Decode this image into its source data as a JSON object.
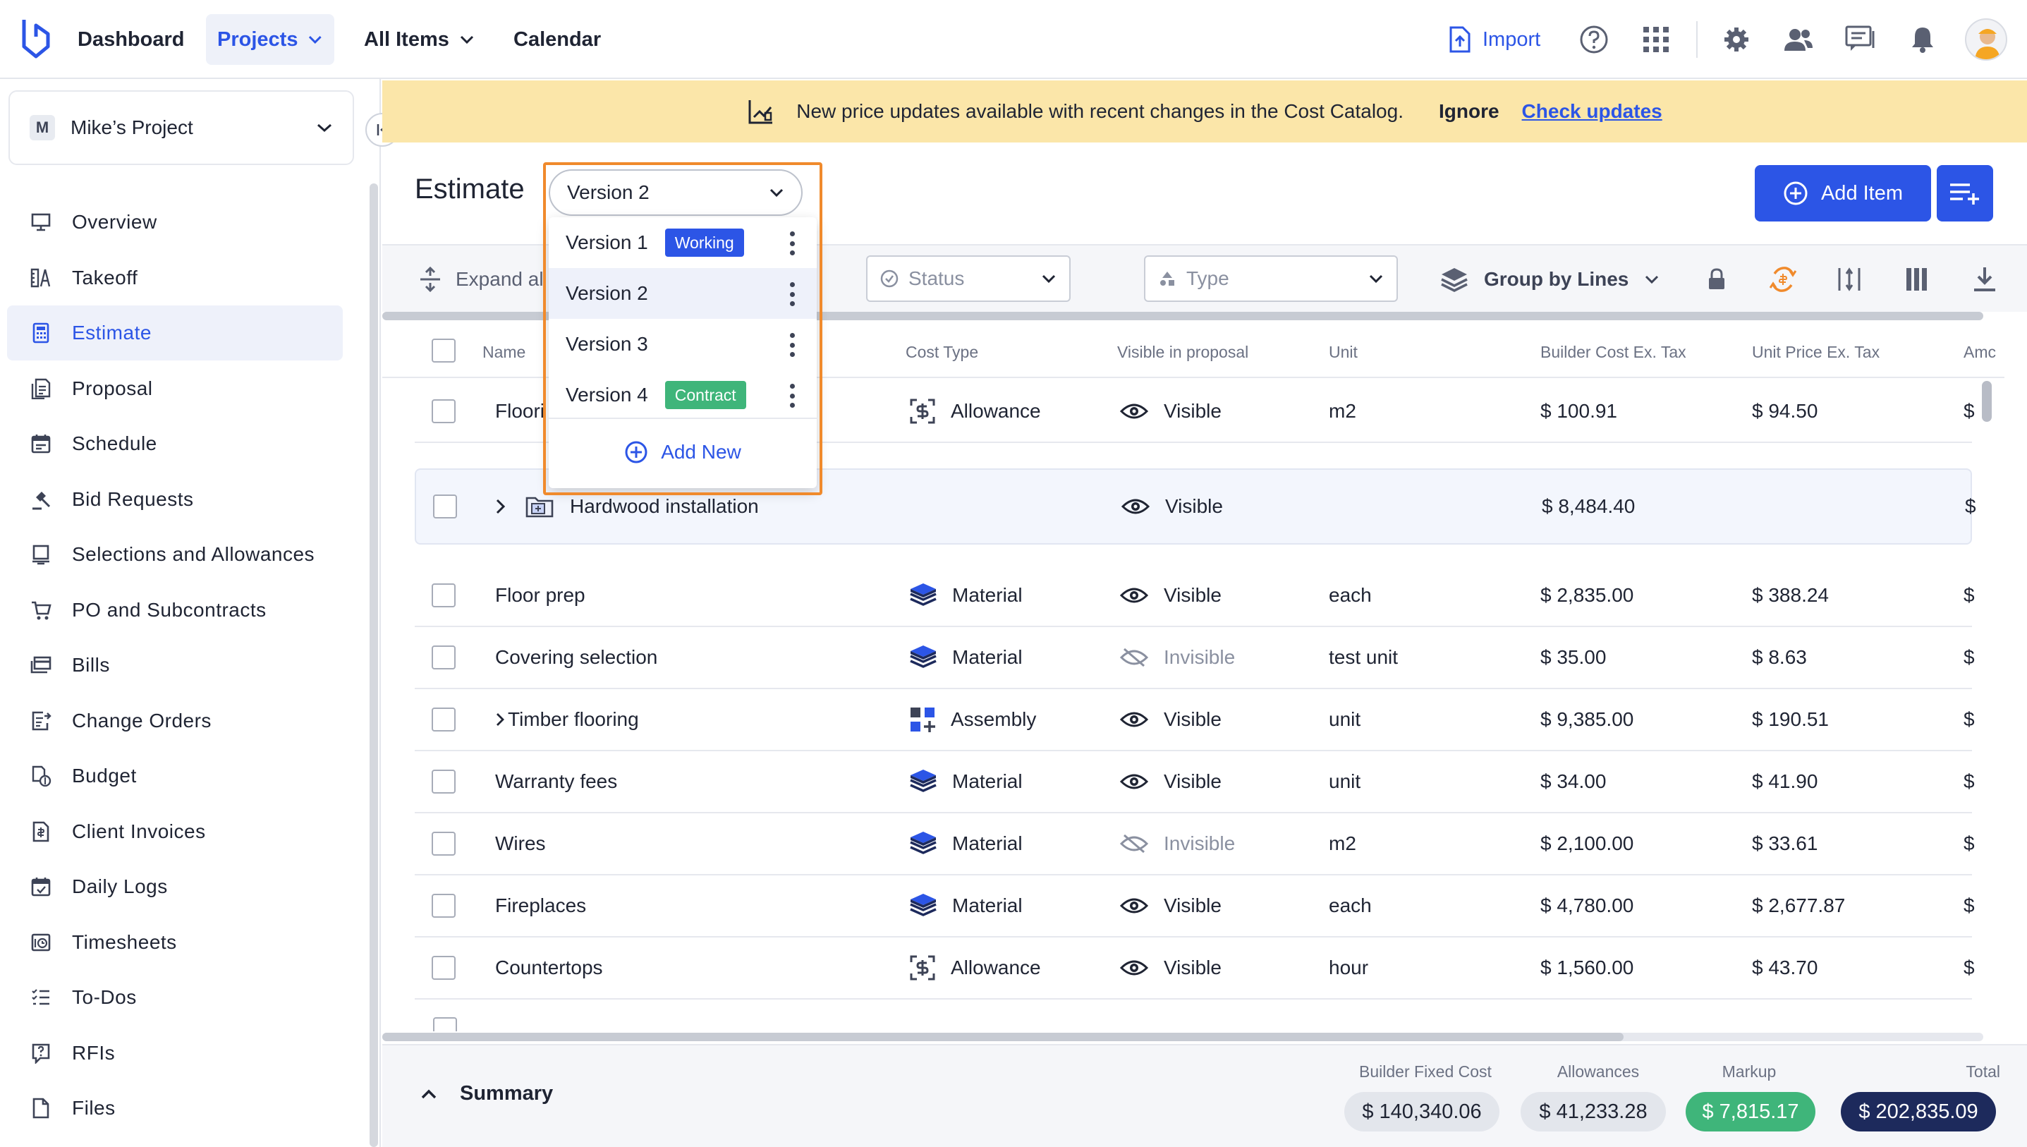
{
  "topnav": {
    "items": [
      {
        "label": "Dashboard"
      },
      {
        "label": "Projects"
      },
      {
        "label": "All Items"
      },
      {
        "label": "Calendar"
      }
    ],
    "import_label": "Import"
  },
  "project": {
    "badge": "M",
    "name": "Mike’s Project"
  },
  "sidebar": {
    "items": [
      {
        "label": "Overview",
        "icon": "monitor-icon"
      },
      {
        "label": "Takeoff",
        "icon": "takeoff-icon"
      },
      {
        "label": "Estimate",
        "icon": "calculator-icon"
      },
      {
        "label": "Proposal",
        "icon": "proposal-icon"
      },
      {
        "label": "Schedule",
        "icon": "calendar-icon"
      },
      {
        "label": "Bid Requests",
        "icon": "gavel-icon"
      },
      {
        "label": "Selections and Allowances",
        "icon": "selections-icon"
      },
      {
        "label": "PO and Subcontracts",
        "icon": "cart-icon"
      },
      {
        "label": "Bills",
        "icon": "bills-icon"
      },
      {
        "label": "Change Orders",
        "icon": "change-orders-icon"
      },
      {
        "label": "Budget",
        "icon": "budget-icon"
      },
      {
        "label": "Client Invoices",
        "icon": "invoice-icon"
      },
      {
        "label": "Daily Logs",
        "icon": "daily-log-icon"
      },
      {
        "label": "Timesheets",
        "icon": "timesheet-icon"
      },
      {
        "label": "To-Dos",
        "icon": "todo-icon"
      },
      {
        "label": "RFIs",
        "icon": "rfi-icon"
      },
      {
        "label": "Files",
        "icon": "file-icon"
      }
    ]
  },
  "banner": {
    "message": "New price updates available with recent changes in the Cost Catalog.",
    "ignore": "Ignore",
    "check": "Check updates"
  },
  "estimate": {
    "title": "Estimate",
    "add_item": "Add Item",
    "version_selected": "Version 2",
    "versions": [
      {
        "label": "Version 1",
        "badge": "Working",
        "badge_color": "#2c55e6"
      },
      {
        "label": "Version 2",
        "badge": "",
        "badge_color": ""
      },
      {
        "label": "Version 3",
        "badge": "",
        "badge_color": ""
      },
      {
        "label": "Version 4",
        "badge": "Contract",
        "badge_color": "#3fb57a"
      }
    ],
    "add_new": "Add New"
  },
  "toolbar": {
    "expand": "Expand al",
    "status_placeholder": "Status",
    "type_placeholder": "Type",
    "group_by": "Group by Lines"
  },
  "table": {
    "headers": {
      "name": "Name",
      "cost_type": "Cost Type",
      "visible": "Visible in proposal",
      "unit": "Unit",
      "builder_cost": "Builder Cost Ex. Tax",
      "unit_price": "Unit Price Ex. Tax",
      "amount": "Amc"
    },
    "rows": [
      {
        "name": "Floori",
        "cost_type": "Allowance",
        "visible": "Visible",
        "unit": "m2",
        "builder_cost": "$ 100.91",
        "unit_price": "$ 94.50",
        "amount": "$"
      },
      {
        "name": "Hardwood installation",
        "cost_type": "",
        "visible": "Visible",
        "unit": "",
        "builder_cost": "$ 8,484.40",
        "unit_price": "",
        "amount": "$"
      },
      {
        "name": "Floor prep",
        "cost_type": "Material",
        "visible": "Visible",
        "unit": "each",
        "builder_cost": "$ 2,835.00",
        "unit_price": "$ 388.24",
        "amount": "$"
      },
      {
        "name": "Covering selection",
        "cost_type": "Material",
        "visible": "Invisible",
        "unit": "test unit",
        "builder_cost": "$ 35.00",
        "unit_price": "$ 8.63",
        "amount": "$"
      },
      {
        "name": "Timber flooring",
        "cost_type": "Assembly",
        "visible": "Visible",
        "unit": "unit",
        "builder_cost": "$ 9,385.00",
        "unit_price": "$ 190.51",
        "amount": "$"
      },
      {
        "name": "Warranty fees",
        "cost_type": "Material",
        "visible": "Visible",
        "unit": "unit",
        "builder_cost": "$ 34.00",
        "unit_price": "$ 41.90",
        "amount": "$"
      },
      {
        "name": "Wires",
        "cost_type": "Material",
        "visible": "Invisible",
        "unit": "m2",
        "builder_cost": "$ 2,100.00",
        "unit_price": "$ 33.61",
        "amount": "$"
      },
      {
        "name": "Fireplaces",
        "cost_type": "Material",
        "visible": "Visible",
        "unit": "each",
        "builder_cost": "$ 4,780.00",
        "unit_price": "$ 2,677.87",
        "amount": "$"
      },
      {
        "name": "Countertops",
        "cost_type": "Allowance",
        "visible": "Visible",
        "unit": "hour",
        "builder_cost": "$ 1,560.00",
        "unit_price": "$ 43.70",
        "amount": "$"
      }
    ]
  },
  "summary": {
    "title": "Summary",
    "builder_fixed_cost_label": "Builder Fixed Cost",
    "builder_fixed_cost": "$ 140,340.06",
    "allowances_label": "Allowances",
    "allowances": "$ 41,233.28",
    "markup_label": "Markup",
    "markup": "$ 7,815.17",
    "total_label": "Total",
    "total": "$ 202,835.09"
  },
  "colors": {
    "accent": "#2c55e6",
    "banner": "#fbe6a9",
    "highlight_outline": "#f08a2c",
    "markup_pill": "#3fb57a",
    "total_pill": "#1d2a5c"
  }
}
